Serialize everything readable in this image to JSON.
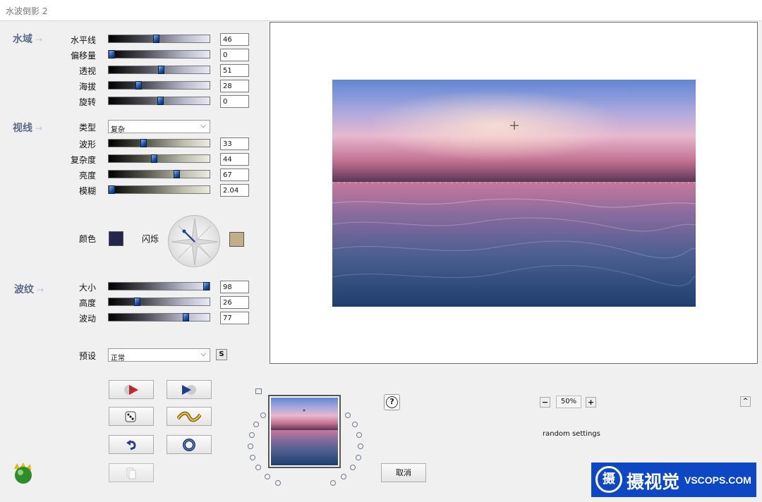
{
  "window": {
    "title": "水波倒影 2"
  },
  "sections": {
    "water": "水域",
    "sight": "视线",
    "ripple": "波纹",
    "arrow": "→"
  },
  "water": [
    {
      "label": "水平线",
      "value": "46",
      "pct": 46
    },
    {
      "label": "偏移量",
      "value": "0",
      "pct": 0
    },
    {
      "label": "透视",
      "value": "51",
      "pct": 51
    },
    {
      "label": "海拔",
      "value": "28",
      "pct": 28
    },
    {
      "label": "旋转",
      "value": "0",
      "pct": 50
    }
  ],
  "sight": {
    "type_label": "类型",
    "type_value": "复杂",
    "sliders": [
      {
        "label": "波形",
        "value": "33",
        "pct": 33
      },
      {
        "label": "复杂度",
        "value": "44",
        "pct": 44
      },
      {
        "label": "亮度",
        "value": "67",
        "pct": 67
      },
      {
        "label": "模糊",
        "value": "2.04",
        "pct": 0
      }
    ],
    "color_label": "颜色",
    "color": "#25244a",
    "flash_label": "闪烁",
    "flash_color": "#c2ae87"
  },
  "ripple": [
    {
      "label": "大小",
      "value": "98",
      "pct": 98
    },
    {
      "label": "高度",
      "value": "26",
      "pct": 26
    },
    {
      "label": "波动",
      "value": "77",
      "pct": 77
    }
  ],
  "preset": {
    "label": "预设",
    "value": "正常",
    "save": "S"
  },
  "buttons": {
    "cancel": "取消",
    "help": "?"
  },
  "zoom": {
    "minus": "−",
    "value": "50%",
    "plus": "+",
    "collapse": "^"
  },
  "hint": "random settings",
  "watermark": {
    "logo_char": "摄",
    "brand": "摄视觉",
    "site": "VSCOPS.COM"
  }
}
